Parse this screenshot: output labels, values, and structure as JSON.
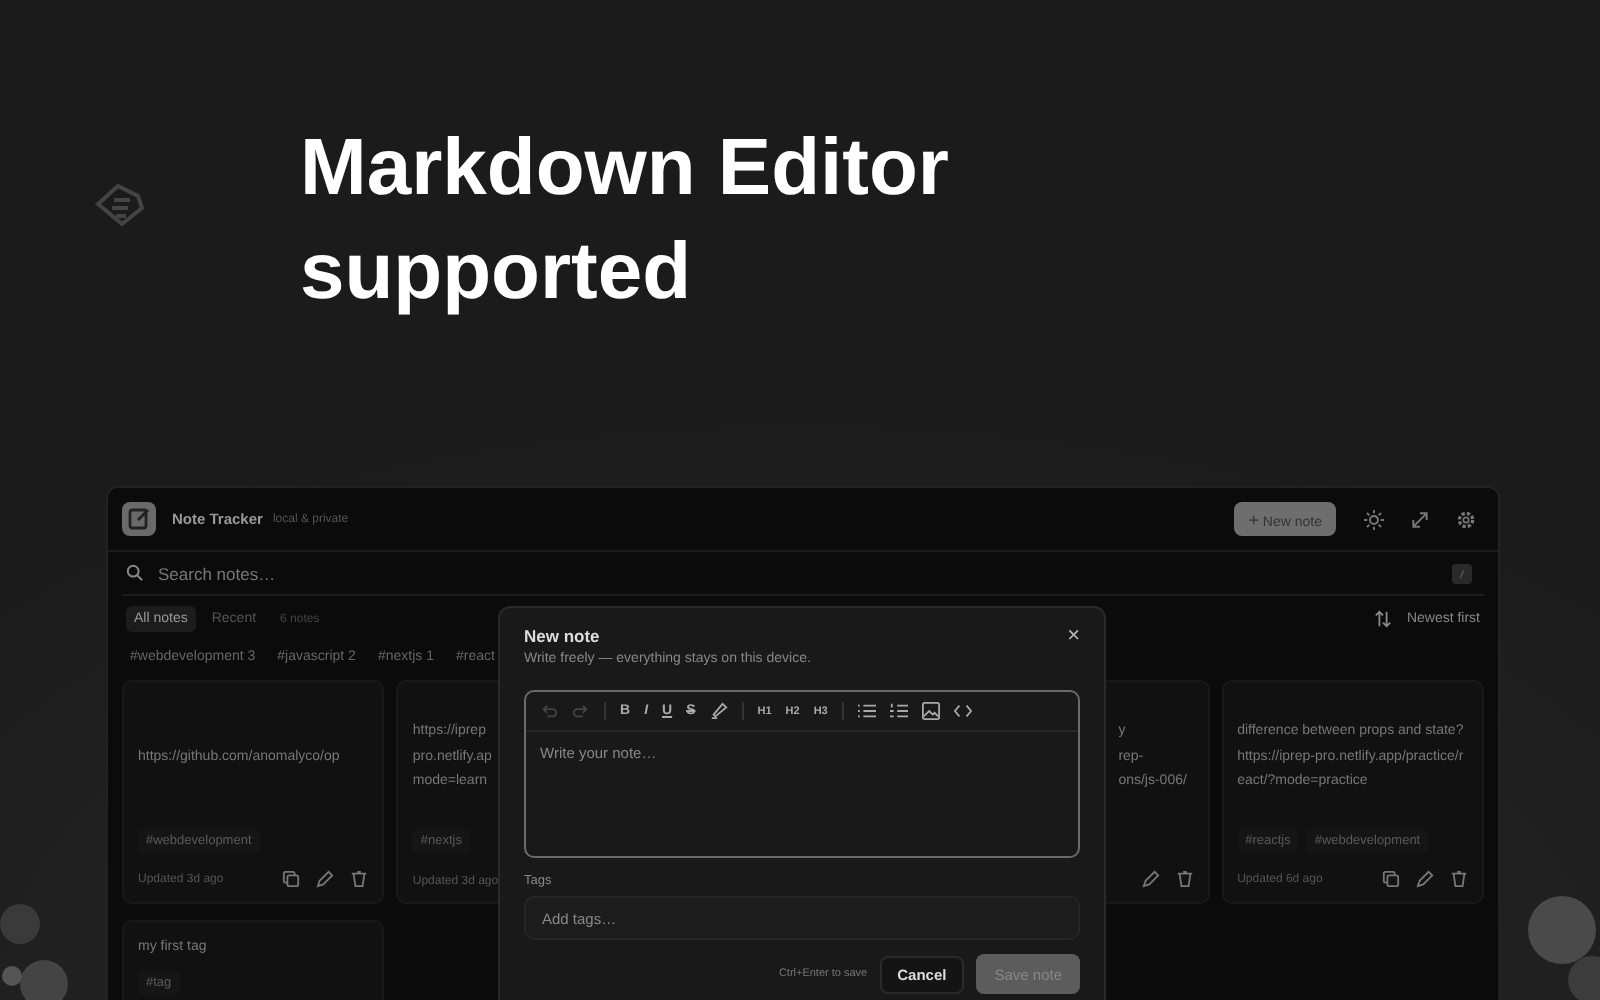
{
  "headline": [
    "Markdown Editor",
    "supported"
  ],
  "app": {
    "name": "Note Tracker",
    "tagline": "local & private",
    "new_note": {
      "icon": "+",
      "label": "New note"
    },
    "search": {
      "placeholder": "Search notes…"
    },
    "tabs": [
      {
        "label": "All notes",
        "selected": true
      },
      {
        "label": "Recent",
        "selected": false
      }
    ],
    "count": "6 notes",
    "sort": "Newest first",
    "tag_filters": [
      "#webdevelopment 3",
      "#javascript 2",
      "#nextjs 1",
      "#react"
    ],
    "cards": [
      {
        "kind": "full",
        "lines": [
          "https://github.com/anomalyco/op"
        ],
        "tags": [
          "#webdevelopment"
        ],
        "updated": "Updated 3d ago"
      },
      {
        "kind": "plain",
        "lines": [
          "https://iprep",
          "pro.netlify.ap",
          "mode=learn"
        ],
        "tags": [
          "#nextjs"
        ],
        "updated": "Updated 3d ago"
      },
      {
        "kind": "covered",
        "lines": [
          "y",
          "rep-",
          "ons/js-006/"
        ]
      },
      {
        "kind": "full",
        "lines": [
          "difference between props and state? https://iprep-pro.netlify.app/practice/react/?mode=practice"
        ],
        "tags": [
          "#reactjs",
          "#webdevelopment"
        ],
        "updated": "Updated 6d ago"
      },
      {
        "kind": "plain",
        "lines": [
          "my first tag"
        ],
        "tags": [
          "#tag"
        ]
      }
    ]
  },
  "dialog": {
    "title": "New note",
    "subtitle": "Write freely — everything stays on this device.",
    "close": "×",
    "toolbar": [
      {
        "kind": "undo",
        "disabled": true
      },
      {
        "kind": "redo",
        "disabled": true
      },
      {
        "kind": "sep"
      },
      {
        "kind": "text",
        "label": "B",
        "disabled": false
      },
      {
        "kind": "text",
        "label": "I",
        "disabled": false
      },
      {
        "kind": "text",
        "label": "U",
        "disabled": false
      },
      {
        "kind": "text",
        "label": "S",
        "disabled": false
      },
      {
        "kind": "highlight",
        "disabled": false
      },
      {
        "kind": "sep"
      },
      {
        "kind": "text",
        "label": "H1",
        "disabled": false
      },
      {
        "kind": "text",
        "label": "H2",
        "disabled": false
      },
      {
        "kind": "text",
        "label": "H3",
        "disabled": false
      },
      {
        "kind": "sep"
      },
      {
        "kind": "bullets",
        "disabled": false
      },
      {
        "kind": "numbers",
        "disabled": false
      },
      {
        "kind": "image",
        "disabled": false
      },
      {
        "kind": "code",
        "disabled": false
      }
    ],
    "editor_placeholder": "Write your note…",
    "tags_label": "Tags",
    "tags_placeholder": "Add tags…",
    "hint": "Ctrl+Enter to save",
    "cancel": "Cancel",
    "save": {
      "label": "Save note",
      "disabled": true
    }
  }
}
